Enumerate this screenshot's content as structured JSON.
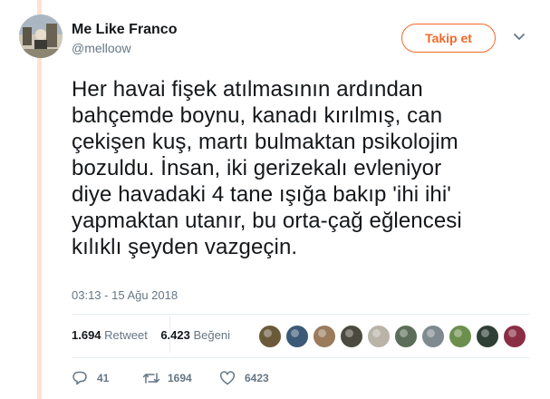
{
  "user": {
    "display_name": "Me Like Franco",
    "handle": "@melloow"
  },
  "follow_button": {
    "label": "Takip et"
  },
  "tweet": {
    "text": "Her havai fişek atılmasının ardından\nbahçemde boynu, kanadı kırılmış, can\nçekişen kuş, martı bulmaktan psikolojim\nbozuldu. İnsan, iki gerizekalı evleniyor\ndiye havadaki 4 tane ışığa bakıp 'ihi ihi'\nyapmaktan utanır, bu orta-çağ eğlencesi\nkılıklı şeyden vazgeçin.",
    "timestamp": "03:13 - 15 Ağu 2018"
  },
  "stats": {
    "retweets_count": "1.694",
    "retweets_label": "Retweet",
    "likes_count": "6.423",
    "likes_label": "Beğeni"
  },
  "likers": [
    {
      "icon": "avatar",
      "color": "#6b5a3a"
    },
    {
      "icon": "avatar",
      "color": "#3c5a78"
    },
    {
      "icon": "avatar",
      "color": "#9a7b5c"
    },
    {
      "icon": "avatar",
      "color": "#4a4a40"
    },
    {
      "icon": "avatar",
      "color": "#b9b3a8"
    },
    {
      "icon": "avatar",
      "color": "#5c6d5a"
    },
    {
      "icon": "avatar",
      "color": "#7f8a8f"
    },
    {
      "icon": "avatar",
      "color": "#6c8f4e"
    },
    {
      "icon": "avatar",
      "color": "#2f3f36"
    },
    {
      "icon": "avatar",
      "color": "#8a2e45"
    }
  ],
  "actions": {
    "reply_count": "41",
    "retweet_count": "1694",
    "like_count": "6423"
  },
  "colors": {
    "accent": "#f26a28",
    "accent_bar": "#fde2d3",
    "muted_text": "#657786",
    "primary_text": "#14171a",
    "divider": "#e6ecf0"
  },
  "icons": {
    "reply": "reply-icon",
    "retweet": "retweet-icon",
    "like": "heart-icon",
    "menu": "chevron-down-icon"
  }
}
